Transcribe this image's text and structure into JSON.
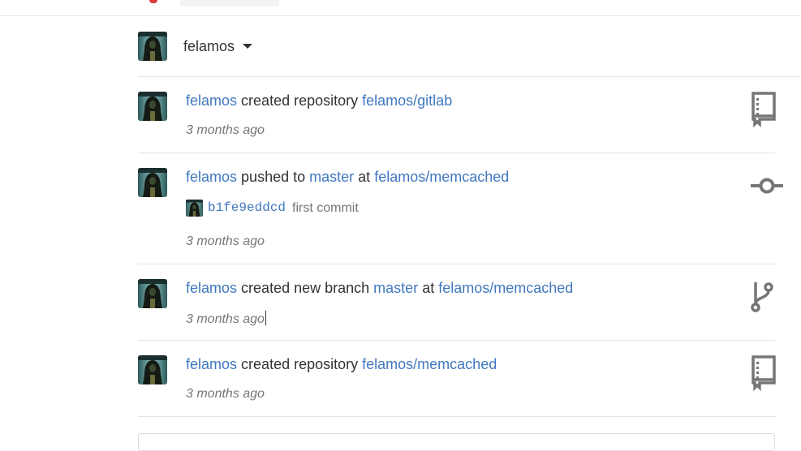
{
  "owner_switcher": {
    "username": "felamos"
  },
  "events": [
    {
      "type": "create-repo",
      "icon": "repo-icon",
      "user": "felamos",
      "action": "created repository",
      "target": "felamos/gitlab",
      "time": "3 months ago"
    },
    {
      "type": "push",
      "icon": "commit-icon",
      "user": "felamos",
      "action": "pushed to",
      "branch": "master",
      "at": "at",
      "target": "felamos/memcached",
      "commit": {
        "sha": "b1fe9eddcd",
        "message": "first commit"
      },
      "time": "3 months ago"
    },
    {
      "type": "create-branch",
      "icon": "branch-icon",
      "user": "felamos",
      "action": "created new branch",
      "branch": "master",
      "at": "at",
      "target": "felamos/memcached",
      "time": "3 months ago"
    },
    {
      "type": "create-repo",
      "icon": "repo-icon",
      "user": "felamos",
      "action": "created repository",
      "target": "felamos/memcached",
      "time": "3 months ago"
    }
  ],
  "colors": {
    "link": "#4078c0",
    "text": "#333333",
    "muted": "#767676",
    "icon": "#767676",
    "border": "#e1e4e8"
  }
}
